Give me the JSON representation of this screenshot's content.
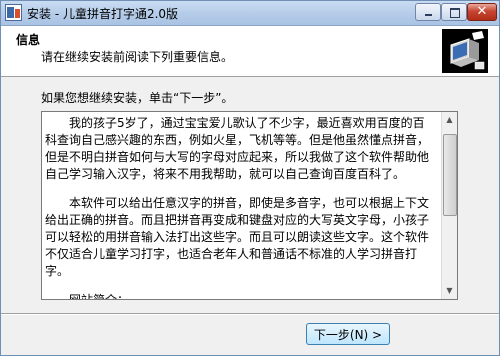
{
  "window": {
    "title": "安装 - 儿童拼音打字通2.0版",
    "icons": {
      "app": "installer-app-icon",
      "minimize": "minimize-icon",
      "maximize": "maximize-icon",
      "close": "close-icon",
      "header": "computer-setup-logo"
    },
    "close_glyph": "✕"
  },
  "header": {
    "title": "信息",
    "subtitle": "请在继续安装前阅读下列重要信息。"
  },
  "body": {
    "prompt": "如果您想继续安装，单击“下一步”。",
    "info_paragraphs": [
      "我的孩子5岁了，通过宝宝爱儿歌认了不少字，最近喜欢用百度的百科查询自己感兴趣的东西，例如火星，飞机等等。但是他虽然懂点拼音，但是不明白拼音如何与大写的字母对应起来，所以我做了这个软件帮助他自己学习输入汉字，将来不用我帮助，就可以自己查询百度百科了。",
      "本软件可以给出任意汉字的拼音，即使是多音字，也可以根据上下文给出正确的拼音。而且把拼音再变成和键盘对应的大写英文字母，小孩子可以轻松的用拼音输入法打出这些字。而且可以朗读这些文字。这个软件不仅适合儿童学习打字，也适合老年人和普通话不标准的人学习拼音打字。",
      "网站简介："
    ]
  },
  "footer": {
    "next_button": "下一步(N) >"
  }
}
